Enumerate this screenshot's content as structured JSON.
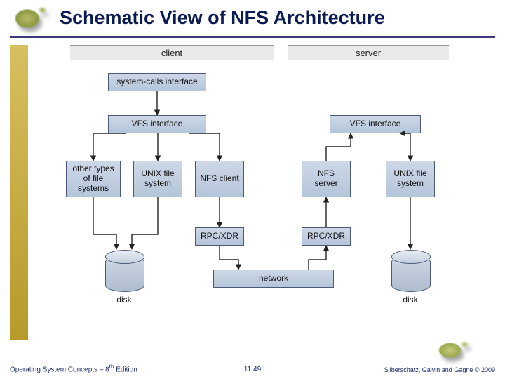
{
  "title": "Schematic View of NFS Architecture",
  "columns": {
    "client": "client",
    "server": "server"
  },
  "nodes": {
    "syscalls": "system-calls interface",
    "vfs_client": "VFS interface",
    "vfs_server": "VFS interface",
    "other_fs": "other types of file systems",
    "unix_client": "UNIX file system",
    "nfs_client": "NFS client",
    "nfs_server": "NFS server",
    "unix_server": "UNIX file system",
    "rpc_client": "RPC/XDR",
    "rpc_server": "RPC/XDR",
    "network": "network"
  },
  "disks": {
    "client": "disk",
    "server": "disk"
  },
  "footer": {
    "left_prefix": "Operating System Concepts – 8",
    "left_suffix": " Edition",
    "left_sup": "th",
    "center": "11.49",
    "right": "Silberschatz, Galvin and Gagne © 2009"
  },
  "chart_data": {
    "type": "diagram",
    "title": "Schematic View of NFS Architecture",
    "groups": {
      "client": [
        "syscalls",
        "vfs_client",
        "other_fs",
        "unix_client",
        "nfs_client",
        "rpc_client",
        "disk_client"
      ],
      "server": [
        "vfs_server",
        "nfs_server",
        "unix_server",
        "rpc_server",
        "disk_server"
      ]
    },
    "shared": [
      "network"
    ],
    "nodes": [
      {
        "id": "syscalls",
        "label": "system-calls interface"
      },
      {
        "id": "vfs_client",
        "label": "VFS interface"
      },
      {
        "id": "vfs_server",
        "label": "VFS interface"
      },
      {
        "id": "other_fs",
        "label": "other types of file systems"
      },
      {
        "id": "unix_client",
        "label": "UNIX file system"
      },
      {
        "id": "nfs_client",
        "label": "NFS client"
      },
      {
        "id": "nfs_server",
        "label": "NFS server"
      },
      {
        "id": "unix_server",
        "label": "UNIX file system"
      },
      {
        "id": "rpc_client",
        "label": "RPC/XDR"
      },
      {
        "id": "rpc_server",
        "label": "RPC/XDR"
      },
      {
        "id": "network",
        "label": "network"
      },
      {
        "id": "disk_client",
        "label": "disk",
        "shape": "cylinder"
      },
      {
        "id": "disk_server",
        "label": "disk",
        "shape": "cylinder"
      }
    ],
    "edges": [
      {
        "from": "syscalls",
        "to": "vfs_client",
        "dir": "forward"
      },
      {
        "from": "vfs_client",
        "to": "other_fs",
        "dir": "forward"
      },
      {
        "from": "vfs_client",
        "to": "unix_client",
        "dir": "forward"
      },
      {
        "from": "vfs_client",
        "to": "nfs_client",
        "dir": "forward"
      },
      {
        "from": "other_fs",
        "to": "disk_client",
        "dir": "forward"
      },
      {
        "from": "unix_client",
        "to": "disk_client",
        "dir": "forward"
      },
      {
        "from": "nfs_client",
        "to": "rpc_client",
        "dir": "forward"
      },
      {
        "from": "rpc_client",
        "to": "network",
        "dir": "forward"
      },
      {
        "from": "network",
        "to": "rpc_server",
        "dir": "forward"
      },
      {
        "from": "rpc_server",
        "to": "nfs_server",
        "dir": "forward"
      },
      {
        "from": "nfs_server",
        "to": "vfs_server",
        "dir": "forward"
      },
      {
        "from": "vfs_server",
        "to": "unix_server",
        "dir": "both"
      },
      {
        "from": "unix_server",
        "to": "disk_server",
        "dir": "forward"
      }
    ]
  }
}
